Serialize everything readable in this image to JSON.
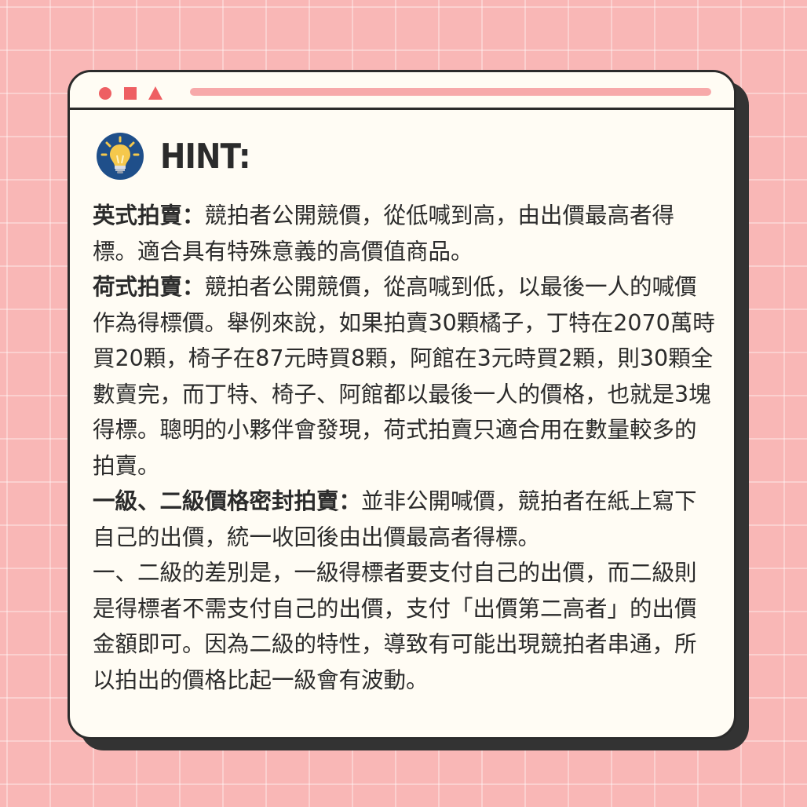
{
  "window": {
    "title_icons": [
      "circle-icon",
      "square-icon",
      "triangle-icon"
    ],
    "accent_color": "#ee5f63",
    "bar_color": "#f7a9aa",
    "background_color": "#f9b7b6"
  },
  "hint": {
    "icon": "lightbulb-icon",
    "title": "HINT:"
  },
  "paragraphs": [
    {
      "term": "英式拍賣：",
      "body": "競拍者公開競價，從低喊到高，由出價最高者得標。適合具有特殊意義的高價值商品。"
    },
    {
      "term": "荷式拍賣：",
      "body": "競拍者公開競價，從高喊到低，以最後一人的喊價作為得標價。舉例來說，如果拍賣30顆橘子，丁特在2070萬時買20顆，椅子在87元時買8顆，阿館在3元時買2顆，則30顆全數賣完，而丁特、椅子、阿館都以最後一人的價格，也就是3塊得標。聰明的小夥伴會發現，荷式拍賣只適合用在數量較多的拍賣。"
    },
    {
      "term": "一級、二級價格密封拍賣：",
      "body": "並非公開喊價，競拍者在紙上寫下自己的出價，統一收回後由出價最高者得標。"
    },
    {
      "term": "",
      "body": "一、二級的差別是，一級得標者要支付自己的出價，而二級則是得標者不需支付自己的出價，支付「出價第二高者」的出價金額即可。因為二級的特性，導致有可能出現競拍者串通，所以拍出的價格比起一級會有波動。"
    }
  ]
}
